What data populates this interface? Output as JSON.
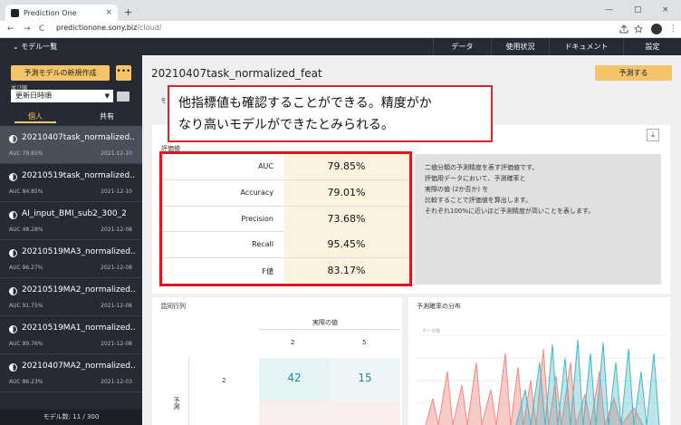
{
  "browser": {
    "tab_title": "Prediction One",
    "tab_close": "×",
    "new_tab": "+",
    "url_host": "predictionone.sony.biz",
    "url_path": "/cloud/",
    "nav_back": "←",
    "nav_forward": "→",
    "nav_reload": "C",
    "window_min": "—",
    "window_max": "□",
    "window_close": "×",
    "menu": "⋮"
  },
  "topbar": {
    "models_label": "モデル一覧",
    "menu_items": [
      "データ",
      "使用状況",
      "ドキュメント",
      "設定"
    ]
  },
  "sidebar": {
    "new_model_button": "予測モデルの新規作成",
    "more_button": "•••",
    "sort_label": "並び順",
    "sort_value": "更新日時順",
    "tabs": [
      "個人",
      "共有"
    ],
    "models": [
      {
        "name": "20210407task_normalized...",
        "auc": "AUC 79.85%",
        "date": "2021-12-10"
      },
      {
        "name": "20210519task_normalized...",
        "auc": "AUC 84.85%",
        "date": "2021-12-10"
      },
      {
        "name": "AI_input_BMI_sub2_300_2",
        "auc": "AUC 48.28%",
        "date": "2021-12-08"
      },
      {
        "name": "20210519MA3_normalized...",
        "auc": "AUC 96.27%",
        "date": "2021-12-08"
      },
      {
        "name": "20210519MA2_normalized...",
        "auc": "AUC 91.75%",
        "date": "2021-12-08"
      },
      {
        "name": "20210519MA1_normalized...",
        "auc": "AUC 89.76%",
        "date": "2021-12-08"
      },
      {
        "name": "20210407MA2_normalized...",
        "auc": "AUC 86.23%",
        "date": "2021-12-03"
      }
    ],
    "model_count": "モデル数: 11 / 300"
  },
  "main": {
    "title": "20210407task_normalized_feat",
    "predict_button": "予測する",
    "subtab_partial": "モ",
    "callout_line1": "他指標値も確認することができる。精度がか",
    "callout_line2": "なり高いモデルができたとみられる。",
    "metrics_title": "評価値",
    "metrics": [
      {
        "label": "AUC",
        "value": "79.85%"
      },
      {
        "label": "Accuracy",
        "value": "79.01%"
      },
      {
        "label": "Precision",
        "value": "73.68%"
      },
      {
        "label": "Recall",
        "value": "95.45%"
      },
      {
        "label": "F値",
        "value": "83.17%"
      }
    ],
    "description": [
      "二値分類の予測精度を表す評価値です。",
      "評価用データにおいて、予測確率と",
      "実際の値 (2か否か) を",
      "比較することで評価値を算出します。",
      "それぞれ100%に近いほど予測精度が高いことを表します。"
    ],
    "download_icon": "⤓",
    "confusion_title": "混同行列",
    "confusion_actual_label": "実際の値",
    "confusion_predicted_label": "予測",
    "confusion_col_headers": [
      "2",
      "5"
    ],
    "confusion_row_header": "2",
    "confusion_values": [
      "42",
      "15"
    ],
    "distribution_title": "予測確率の分布",
    "distribution_ylabel": "データ数"
  },
  "colors": {
    "accent": "#f5c36a",
    "sidebar_bg": "#262a35",
    "highlight_red": "#e0151c",
    "teal": "#45b8c4",
    "salmon": "#f08a84"
  }
}
